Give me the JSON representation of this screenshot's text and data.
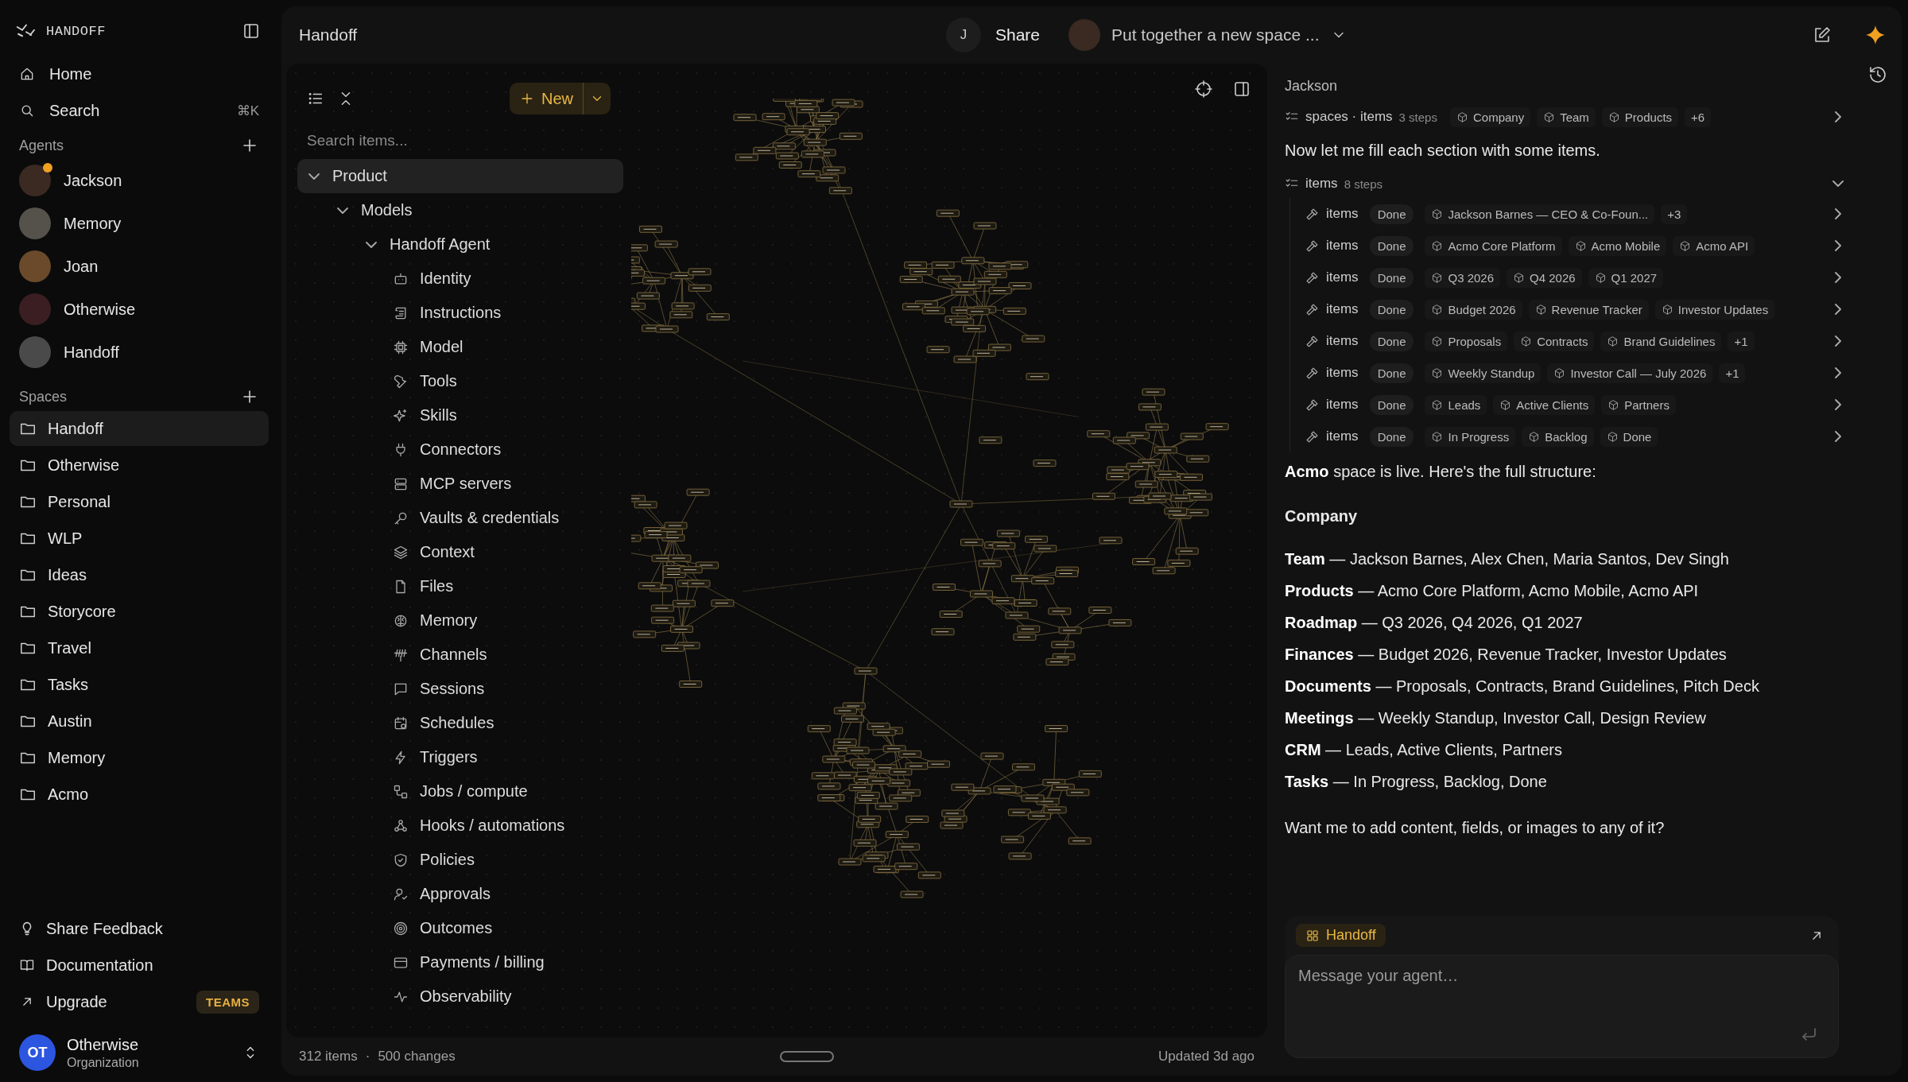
{
  "sidebar": {
    "logo": "HANDOFF",
    "nav": [
      {
        "label": "Home"
      },
      {
        "label": "Search",
        "shortcut": "⌘K"
      }
    ],
    "agents_heading": "Agents",
    "agents": [
      {
        "name": "Jackson",
        "online": true
      },
      {
        "name": "Memory",
        "online": false
      },
      {
        "name": "Joan",
        "online": false
      },
      {
        "name": "Otherwise",
        "online": false
      },
      {
        "name": "Handoff",
        "online": false
      }
    ],
    "spaces_heading": "Spaces",
    "spaces": [
      {
        "label": "Handoff",
        "selected": true
      },
      {
        "label": "Otherwise",
        "selected": false
      },
      {
        "label": "Personal",
        "selected": false
      },
      {
        "label": "WLP",
        "selected": false
      },
      {
        "label": "Ideas",
        "selected": false
      },
      {
        "label": "Storycore",
        "selected": false
      },
      {
        "label": "Travel",
        "selected": false
      },
      {
        "label": "Tasks",
        "selected": false
      },
      {
        "label": "Austin",
        "selected": false
      },
      {
        "label": "Memory",
        "selected": false
      },
      {
        "label": "Acmo",
        "selected": false
      }
    ],
    "links": [
      {
        "kind": "feedback",
        "label": "Share Feedback"
      },
      {
        "kind": "docs",
        "label": "Documentation"
      },
      {
        "kind": "upgrade",
        "label": "Upgrade",
        "badge": "TEAMS"
      }
    ],
    "org": {
      "initials": "OT",
      "name": "Otherwise",
      "role": "Organization"
    }
  },
  "workspace": {
    "title": "Handoff",
    "user_initial": "J",
    "share": "Share",
    "new_button": "New",
    "search": {
      "placeholder": "Search items..."
    },
    "tree": [
      {
        "label": "Product",
        "expanded": true,
        "selected": true,
        "children": [
          {
            "label": "Models",
            "expanded": true,
            "selected": false,
            "children": [
              {
                "label": "Handoff Agent",
                "expanded": true,
                "selected": false,
                "children": [
                  {
                    "label": "Identity",
                    "selected": false
                  },
                  {
                    "label": "Instructions",
                    "selected": false
                  },
                  {
                    "label": "Model",
                    "selected": false
                  },
                  {
                    "label": "Tools",
                    "selected": false
                  },
                  {
                    "label": "Skills",
                    "selected": false
                  },
                  {
                    "label": "Connectors",
                    "selected": false
                  },
                  {
                    "label": "MCP servers",
                    "selected": false
                  },
                  {
                    "label": "Vaults & credentials",
                    "selected": false
                  },
                  {
                    "label": "Context",
                    "selected": false
                  },
                  {
                    "label": "Files",
                    "selected": false
                  },
                  {
                    "label": "Memory",
                    "selected": false
                  },
                  {
                    "label": "Channels",
                    "selected": false
                  },
                  {
                    "label": "Sessions",
                    "selected": false
                  },
                  {
                    "label": "Schedules",
                    "selected": false
                  },
                  {
                    "label": "Triggers",
                    "selected": false
                  },
                  {
                    "label": "Jobs / compute",
                    "selected": false
                  },
                  {
                    "label": "Hooks / automations",
                    "selected": false
                  },
                  {
                    "label": "Policies",
                    "selected": false
                  },
                  {
                    "label": "Approvals",
                    "selected": false
                  },
                  {
                    "label": "Outcomes",
                    "selected": false
                  },
                  {
                    "label": "Payments / billing",
                    "selected": false
                  },
                  {
                    "label": "Observability",
                    "selected": false
                  }
                ]
              }
            ]
          }
        ]
      }
    ],
    "status": {
      "items": "312 items",
      "separator": "·",
      "changes": "500 changes",
      "updated": "Updated 3d ago"
    }
  },
  "chat": {
    "thread_title": "Put together a new space ...",
    "author": "Jackson",
    "messages": [
      {
        "kind": "steps",
        "label": "spaces · items",
        "count": "3 steps",
        "expanded": false,
        "chips": [
          "Company",
          "Team",
          "Products"
        ],
        "more": "+6"
      },
      {
        "kind": "text",
        "text": "Now let me fill each section with some items."
      },
      {
        "kind": "steps",
        "label": "items",
        "count": "8 steps",
        "expanded": true,
        "steps": [
          {
            "label": "items",
            "status": "Done",
            "chips": [
              "Jackson Barnes — CEO & Co-Foun..."
            ],
            "more": "+3"
          },
          {
            "label": "items",
            "status": "Done",
            "chips": [
              "Acmo Core Platform",
              "Acmo Mobile",
              "Acmo API"
            ]
          },
          {
            "label": "items",
            "status": "Done",
            "chips": [
              "Q3 2026",
              "Q4 2026",
              "Q1 2027"
            ]
          },
          {
            "label": "items",
            "status": "Done",
            "chips": [
              "Budget 2026",
              "Revenue Tracker",
              "Investor Updates"
            ]
          },
          {
            "label": "items",
            "status": "Done",
            "chips": [
              "Proposals",
              "Contracts",
              "Brand Guidelines"
            ],
            "more": "+1"
          },
          {
            "label": "items",
            "status": "Done",
            "chips": [
              "Weekly Standup",
              "Investor Call — July 2026"
            ],
            "more": "+1"
          },
          {
            "label": "items",
            "status": "Done",
            "chips": [
              "Leads",
              "Active Clients",
              "Partners"
            ]
          },
          {
            "label": "items",
            "status": "Done",
            "chips": [
              "In Progress",
              "Backlog",
              "Done"
            ]
          }
        ]
      },
      {
        "kind": "text",
        "text": "**Acmo** space is live. Here's the full structure:"
      },
      {
        "kind": "heading",
        "text": "Company"
      },
      {
        "kind": "list",
        "items": [
          "**Team** — Jackson Barnes, Alex Chen, Maria Santos, Dev Singh",
          "**Products** — Acmo Core Platform, Acmo Mobile, Acmo API",
          "**Roadmap** — Q3 2026, Q4 2026, Q1 2027",
          "**Finances** — Budget 2026, Revenue Tracker, Investor Updates",
          "**Documents** — Proposals, Contracts, Brand Guidelines, Pitch Deck",
          "**Meetings** — Weekly Standup, Investor Call, Design Review",
          "**CRM** — Leads, Active Clients, Partners",
          "**Tasks** — In Progress, Backlog, Done"
        ]
      },
      {
        "kind": "text",
        "text": "Want me to add content, fields, or images to any of it?"
      }
    ],
    "composer": {
      "context": "Handoff",
      "placeholder": "Message your agent…"
    }
  }
}
